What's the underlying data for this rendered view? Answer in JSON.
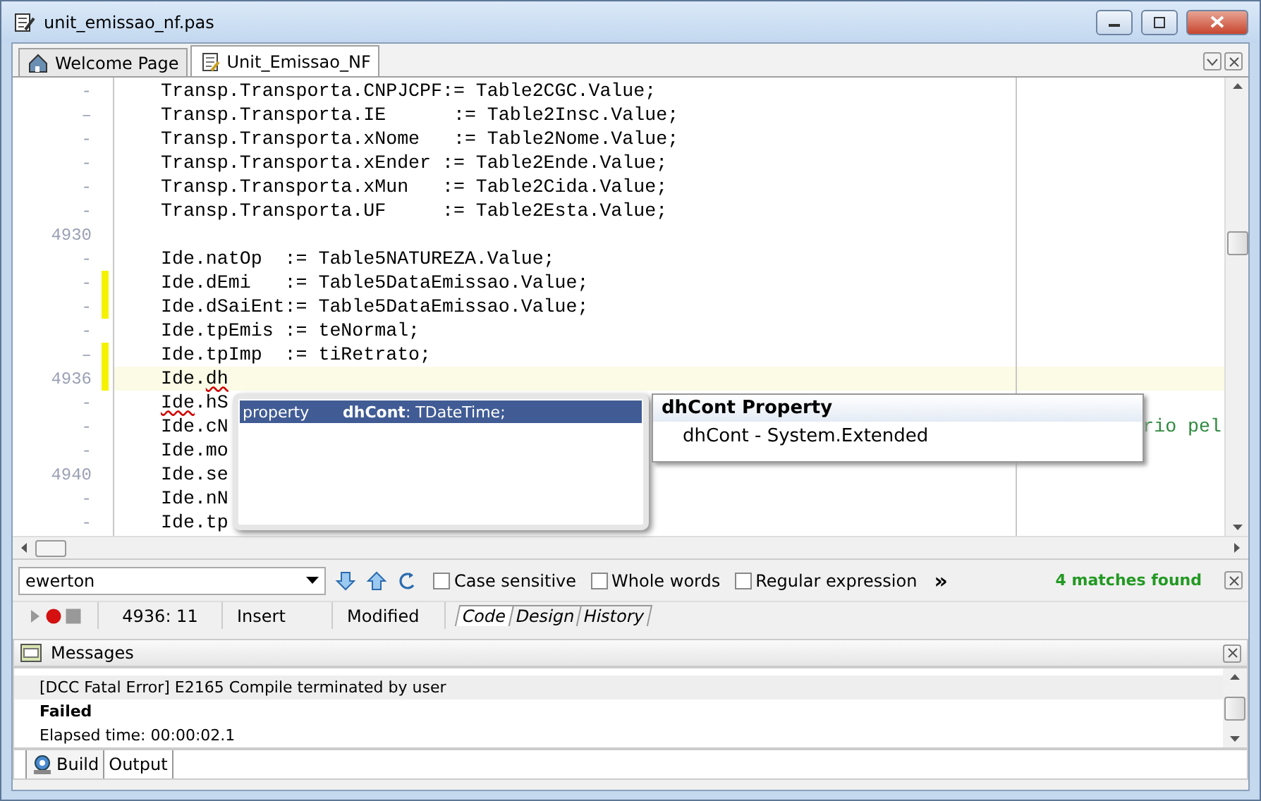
{
  "window": {
    "title": "unit_emissao_nf.pas"
  },
  "editor_tabs": [
    {
      "label": "Welcome Page",
      "selected": false
    },
    {
      "label": "Unit_Emissao_NF",
      "selected": true
    }
  ],
  "editor": {
    "lines": [
      {
        "gutter": "-",
        "modified": false,
        "current": false,
        "segments": [
          {
            "text": "Transp.Transporta.CNPJCPF:= Table2CGC.Value;",
            "error": false
          }
        ]
      },
      {
        "gutter": "–",
        "modified": false,
        "current": false,
        "segments": [
          {
            "text": "Transp.Transporta.IE      := Table2Insc.Value;",
            "error": false
          }
        ]
      },
      {
        "gutter": "-",
        "modified": false,
        "current": false,
        "segments": [
          {
            "text": "Transp.Transporta.xNome   := Table2Nome.Value;",
            "error": false
          }
        ]
      },
      {
        "gutter": "-",
        "modified": false,
        "current": false,
        "segments": [
          {
            "text": "Transp.Transporta.xEnder := Table2Ende.Value;",
            "error": false
          }
        ]
      },
      {
        "gutter": "-",
        "modified": false,
        "current": false,
        "segments": [
          {
            "text": "Transp.Transporta.xMun   := Table2Cida.Value;",
            "error": false
          }
        ]
      },
      {
        "gutter": "-",
        "modified": false,
        "current": false,
        "segments": [
          {
            "text": "Transp.Transporta.UF     := Table2Esta.Value;",
            "error": false
          }
        ]
      },
      {
        "gutter": "4930",
        "modified": false,
        "current": false
      },
      {
        "gutter": "-",
        "modified": false,
        "current": false,
        "segments": [
          {
            "text": "Ide.natOp  := Table5NATUREZA.Value;",
            "error": false
          }
        ]
      },
      {
        "gutter": "-",
        "modified": true,
        "current": false,
        "segments": [
          {
            "text": "Ide.dEmi   := Table5DataEmissao.Value;",
            "error": false
          }
        ]
      },
      {
        "gutter": "-",
        "modified": true,
        "current": false,
        "segments": [
          {
            "text": "Ide.dSaiEnt:= Table5DataEmissao.Value;",
            "error": false
          }
        ]
      },
      {
        "gutter": "-",
        "modified": false,
        "current": false,
        "segments": [
          {
            "text": "Ide.tpEmis := teNormal;",
            "error": false
          }
        ]
      },
      {
        "gutter": "–",
        "modified": true,
        "current": false,
        "segments": [
          {
            "text": "Ide.tpImp  := tiRetrato;",
            "error": false
          }
        ]
      },
      {
        "gutter": "4936",
        "modified": true,
        "current": true,
        "segments": [
          {
            "text": "Ide.",
            "error": false
          },
          {
            "text": "dh",
            "error": true
          }
        ]
      },
      {
        "gutter": "-",
        "modified": false,
        "current": false,
        "segments": [
          {
            "text": "Ide",
            "error": true
          },
          {
            "text": ".hS",
            "error": false
          }
        ]
      },
      {
        "gutter": "-",
        "modified": false,
        "current": false,
        "segments": [
          {
            "text": "Ide.cN",
            "error": false
          }
        ],
        "trailing": "rio pel"
      },
      {
        "gutter": "-",
        "modified": false,
        "current": false,
        "segments": [
          {
            "text": "Ide.mo",
            "error": false
          }
        ]
      },
      {
        "gutter": "4940",
        "modified": false,
        "current": false,
        "segments": [
          {
            "text": "Ide.se",
            "error": false
          }
        ]
      },
      {
        "gutter": "-",
        "modified": false,
        "current": false,
        "segments": [
          {
            "text": "Ide.nN",
            "error": false
          }
        ]
      },
      {
        "gutter": "-",
        "modified": false,
        "current": false,
        "segments": [
          {
            "text": "Ide.tp",
            "error": false
          }
        ]
      }
    ],
    "completion": {
      "items": [
        {
          "kind": "property",
          "signature": "**dhCont**: TDateTime;",
          "selected": true
        }
      ]
    },
    "hint": {
      "title": "dhCont Property",
      "body": "dhCont - System.Extended"
    }
  },
  "search_bar": {
    "value": "ewerton",
    "options": [
      {
        "label": "Case sensitive",
        "checked": false
      },
      {
        "label": "Whole words",
        "checked": false
      },
      {
        "label": "Regular expression",
        "checked": false
      }
    ],
    "more": "»",
    "status": "4 matches found"
  },
  "status_bar": {
    "position": "4936: 11",
    "mode": "Insert",
    "state": "Modified",
    "view_tabs": [
      {
        "label": "Code",
        "selected": true
      },
      {
        "label": "Design",
        "selected": false
      },
      {
        "label": "History",
        "selected": false
      }
    ]
  },
  "messages": {
    "title": "Messages",
    "lines": [
      {
        "text": "[DCC Fatal Error] E2165 Compile terminated by user",
        "bold": false,
        "selected": true
      },
      {
        "text": "Failed",
        "bold": true,
        "selected": false
      },
      {
        "text": "Elapsed time: 00:00:02.1",
        "bold": false,
        "selected": false
      }
    ],
    "tabs": [
      {
        "label": "Build",
        "selected": true
      },
      {
        "label": "Output",
        "selected": false
      }
    ]
  }
}
